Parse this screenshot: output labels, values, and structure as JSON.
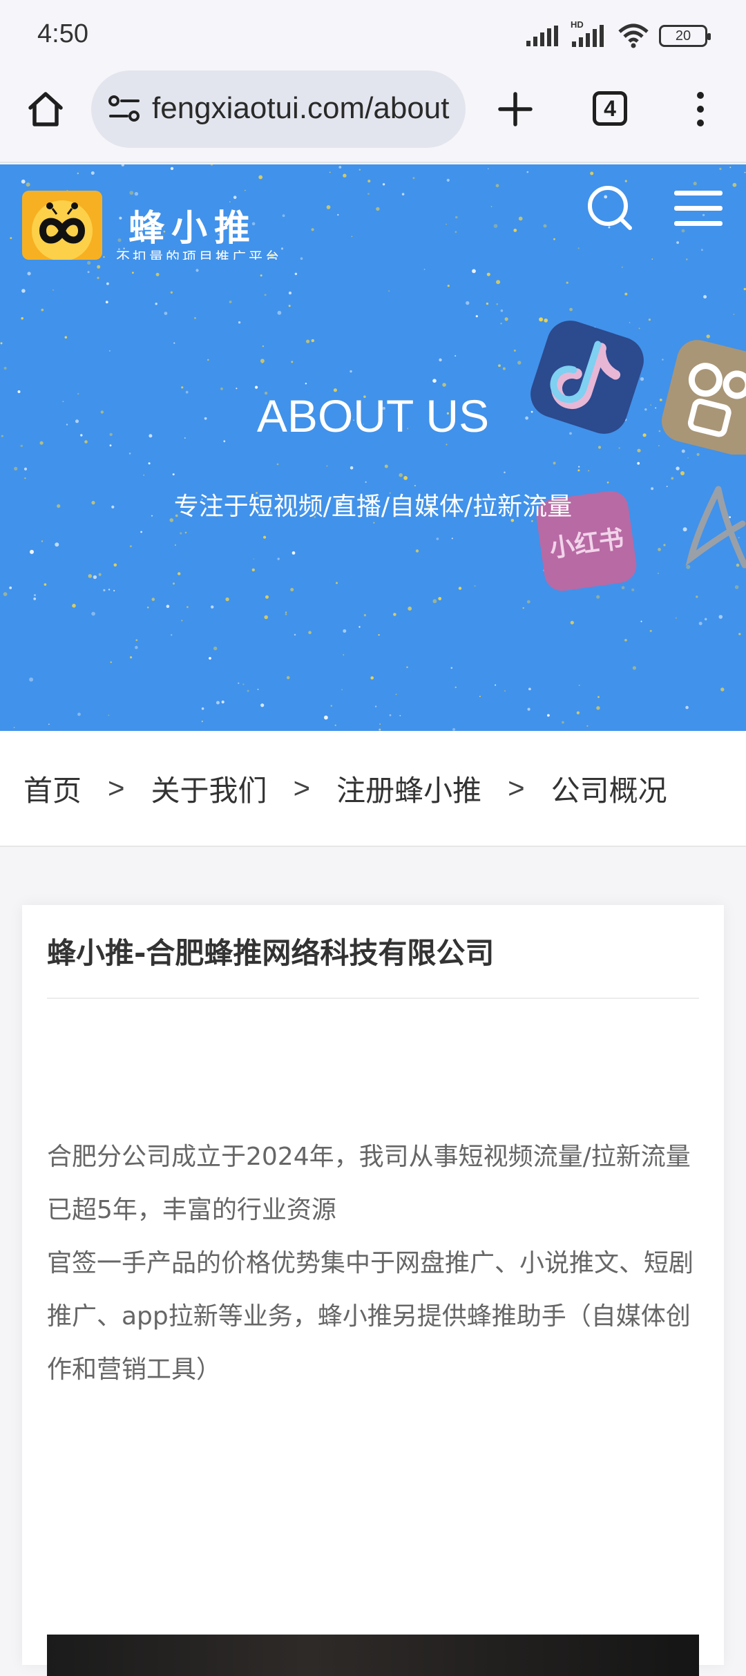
{
  "status_bar": {
    "time": "4:50",
    "network_label": "HD",
    "battery": "20"
  },
  "browser": {
    "url": "fengxiaotui.com/about",
    "tab_count": "4",
    "icons": [
      "home-icon",
      "site-info-icon",
      "plus-icon",
      "tabs-icon",
      "more-vert-icon"
    ]
  },
  "header": {
    "logo_name": "蜂小推",
    "logo_slogan": "不扣量的项目推广平台",
    "icons": [
      "search-icon",
      "menu-icon"
    ]
  },
  "hero": {
    "title": "ABOUT US",
    "subtitle": "专注于短视频/直播/自媒体/拉新流量",
    "badge_xhs": "小红书",
    "background_color": "#4192ea"
  },
  "breadcrumb": [
    "首页",
    "关于我们",
    "注册蜂小推",
    "公司概况"
  ],
  "breadcrumb_separator": ">",
  "article": {
    "title": "蜂小推-合肥蜂推网络科技有限公司",
    "paragraphs": [
      "合肥分公司成立于2024年，我司从事短视频流量/拉新流量已超5年，丰富的行业资源",
      "官签一手产品的价格优势集中于网盘推广、小说推文、短剧推广、app拉新等业务，蜂小推另提供蜂推助手（自媒体创作和营销工具）"
    ]
  }
}
